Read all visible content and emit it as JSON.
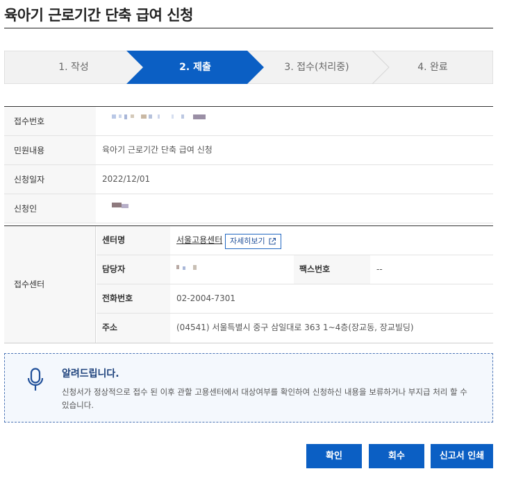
{
  "page": {
    "title": "육아기 근로기간 단축 급여 신청"
  },
  "steps": [
    {
      "label": "1. 작성",
      "active": false
    },
    {
      "label": "2. 제출",
      "active": true
    },
    {
      "label": "3. 접수(처리중)",
      "active": false
    },
    {
      "label": "4. 완료",
      "active": false
    }
  ],
  "info": {
    "receipt_no_label": "접수번호",
    "service_label": "민원내용",
    "service_value": "육아기 근로기간 단축 급여 신청",
    "date_label": "신청일자",
    "date_value": "2022/12/01",
    "applicant_label": "신청인"
  },
  "center": {
    "section_label": "접수센터",
    "name_label": "센터명",
    "name_value": "서울고용센터",
    "detail_button": "자세히보기",
    "manager_label": "담당자",
    "fax_label": "팩스번호",
    "fax_value": "--",
    "phone_label": "전화번호",
    "phone_value": "02-2004-7301",
    "address_label": "주소",
    "address_value": "(04541) 서울특별시 중구 삼일대로 363 1~4층(장교동, 장교빌딩)"
  },
  "notice": {
    "title": "알려드립니다.",
    "body": "신청서가 정상적으로 접수 된 이후 관할 고용센터에서 대상여부를 확인하여 신청하신 내용을 보류하거나 부지급 처리 할 수 있습니다."
  },
  "buttons": {
    "confirm": "확인",
    "withdraw": "회수",
    "print": "신고서 인쇄"
  },
  "colors": {
    "accent": "#0b5fc4",
    "step_inactive": "#f2f2f2"
  }
}
